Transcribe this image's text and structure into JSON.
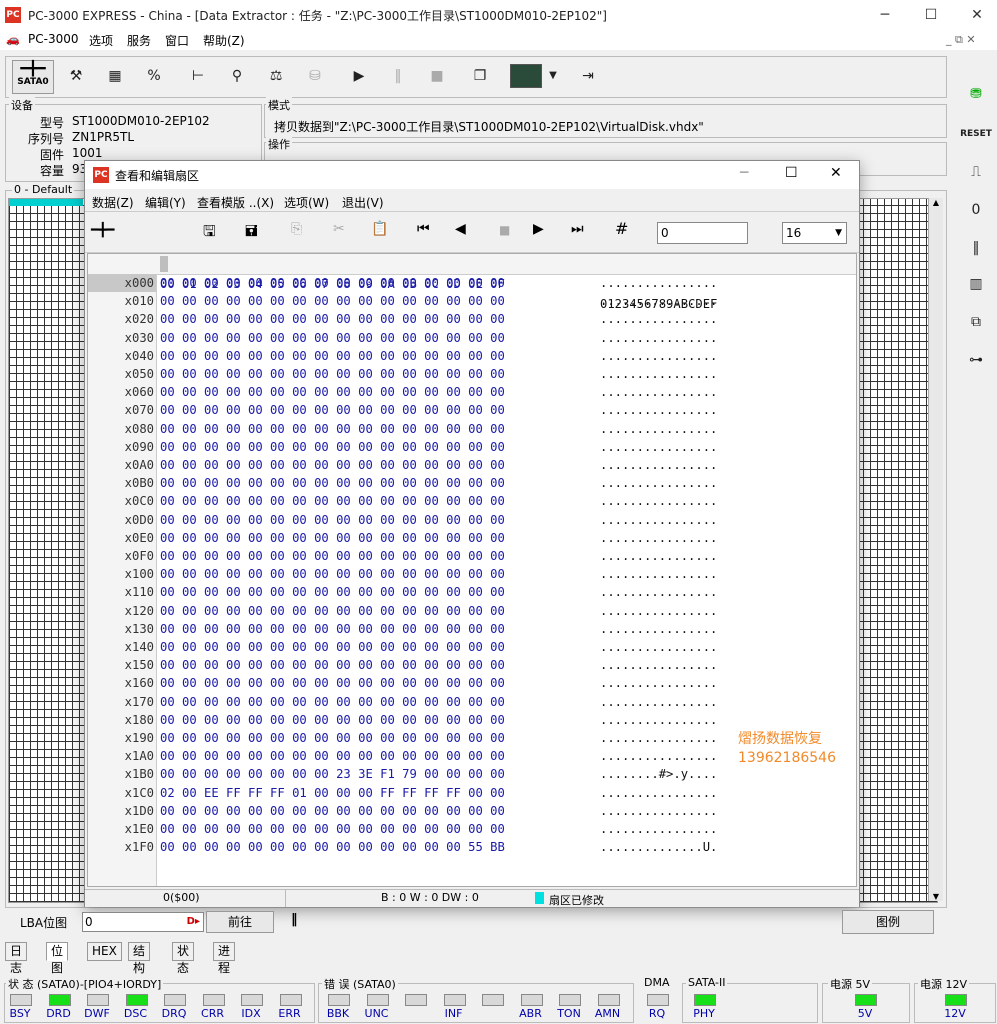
{
  "window": {
    "title": "PC-3000 EXPRESS - China - [Data Extractor : 任务 - \"Z:\\PC-3000工作目录\\ST1000DM010-2EP102\"]",
    "icon": "PC"
  },
  "menu": [
    "PC-3000",
    "选项",
    "服务",
    "窗口",
    "帮助(Z)"
  ],
  "toolbar": {
    "sata_label": "SATA0"
  },
  "device": {
    "group_label": "设备",
    "model_label": "型号",
    "model": "ST1000DM010-2EP102",
    "serial_label": "序列号",
    "serial": "ZN1PR5TL",
    "firmware_label": "固件",
    "firmware": "1001",
    "capacity_label": "容量",
    "capacity": "93"
  },
  "mode": {
    "group_label": "模式",
    "text": "拷贝数据到\"Z:\\PC-3000工作目录\\ST1000DM010-2EP102\\VirtualDisk.vhdx\""
  },
  "operation": {
    "group_label": "操作"
  },
  "map_label": "0 - Default",
  "dialog": {
    "title": "查看和编辑扇区",
    "menu": [
      "数据(Z)",
      "编辑(Y)",
      "查看模版 ..(X)",
      "选项(W)",
      "退出(V)"
    ],
    "sector_input": "0",
    "columns_select": "16",
    "header_hex": "00 01 02 03 04 05 06 07 08 09 0A 0B 0C 0D 0E 0F",
    "header_ascii": "0123456789ABCDEF",
    "rows": [
      {
        "off": "x000",
        "hex": "00 00 00 00 00 00 00 00 00 00 00 00 00 00 00 00",
        "ascii": "................"
      },
      {
        "off": "x010",
        "hex": "00 00 00 00 00 00 00 00 00 00 00 00 00 00 00 00",
        "ascii": "................"
      },
      {
        "off": "x020",
        "hex": "00 00 00 00 00 00 00 00 00 00 00 00 00 00 00 00",
        "ascii": "................"
      },
      {
        "off": "x030",
        "hex": "00 00 00 00 00 00 00 00 00 00 00 00 00 00 00 00",
        "ascii": "................"
      },
      {
        "off": "x040",
        "hex": "00 00 00 00 00 00 00 00 00 00 00 00 00 00 00 00",
        "ascii": "................"
      },
      {
        "off": "x050",
        "hex": "00 00 00 00 00 00 00 00 00 00 00 00 00 00 00 00",
        "ascii": "................"
      },
      {
        "off": "x060",
        "hex": "00 00 00 00 00 00 00 00 00 00 00 00 00 00 00 00",
        "ascii": "................"
      },
      {
        "off": "x070",
        "hex": "00 00 00 00 00 00 00 00 00 00 00 00 00 00 00 00",
        "ascii": "................"
      },
      {
        "off": "x080",
        "hex": "00 00 00 00 00 00 00 00 00 00 00 00 00 00 00 00",
        "ascii": "................"
      },
      {
        "off": "x090",
        "hex": "00 00 00 00 00 00 00 00 00 00 00 00 00 00 00 00",
        "ascii": "................"
      },
      {
        "off": "x0A0",
        "hex": "00 00 00 00 00 00 00 00 00 00 00 00 00 00 00 00",
        "ascii": "................"
      },
      {
        "off": "x0B0",
        "hex": "00 00 00 00 00 00 00 00 00 00 00 00 00 00 00 00",
        "ascii": "................"
      },
      {
        "off": "x0C0",
        "hex": "00 00 00 00 00 00 00 00 00 00 00 00 00 00 00 00",
        "ascii": "................"
      },
      {
        "off": "x0D0",
        "hex": "00 00 00 00 00 00 00 00 00 00 00 00 00 00 00 00",
        "ascii": "................"
      },
      {
        "off": "x0E0",
        "hex": "00 00 00 00 00 00 00 00 00 00 00 00 00 00 00 00",
        "ascii": "................"
      },
      {
        "off": "x0F0",
        "hex": "00 00 00 00 00 00 00 00 00 00 00 00 00 00 00 00",
        "ascii": "................"
      },
      {
        "off": "x100",
        "hex": "00 00 00 00 00 00 00 00 00 00 00 00 00 00 00 00",
        "ascii": "................"
      },
      {
        "off": "x110",
        "hex": "00 00 00 00 00 00 00 00 00 00 00 00 00 00 00 00",
        "ascii": "................"
      },
      {
        "off": "x120",
        "hex": "00 00 00 00 00 00 00 00 00 00 00 00 00 00 00 00",
        "ascii": "................"
      },
      {
        "off": "x130",
        "hex": "00 00 00 00 00 00 00 00 00 00 00 00 00 00 00 00",
        "ascii": "................"
      },
      {
        "off": "x140",
        "hex": "00 00 00 00 00 00 00 00 00 00 00 00 00 00 00 00",
        "ascii": "................"
      },
      {
        "off": "x150",
        "hex": "00 00 00 00 00 00 00 00 00 00 00 00 00 00 00 00",
        "ascii": "................"
      },
      {
        "off": "x160",
        "hex": "00 00 00 00 00 00 00 00 00 00 00 00 00 00 00 00",
        "ascii": "................"
      },
      {
        "off": "x170",
        "hex": "00 00 00 00 00 00 00 00 00 00 00 00 00 00 00 00",
        "ascii": "................"
      },
      {
        "off": "x180",
        "hex": "00 00 00 00 00 00 00 00 00 00 00 00 00 00 00 00",
        "ascii": "................"
      },
      {
        "off": "x190",
        "hex": "00 00 00 00 00 00 00 00 00 00 00 00 00 00 00 00",
        "ascii": "................"
      },
      {
        "off": "x1A0",
        "hex": "00 00 00 00 00 00 00 00 00 00 00 00 00 00 00 00",
        "ascii": "................"
      },
      {
        "off": "x1B0",
        "hex": "00 00 00 00 00 00 00 00 23 3E F1 79 00 00 00 00",
        "ascii": "........#>.y...."
      },
      {
        "off": "x1C0",
        "hex": "02 00 EE FF FF FF 01 00 00 00 FF FF FF FF 00 00",
        "ascii": "................"
      },
      {
        "off": "x1D0",
        "hex": "00 00 00 00 00 00 00 00 00 00 00 00 00 00 00 00",
        "ascii": "................"
      },
      {
        "off": "x1E0",
        "hex": "00 00 00 00 00 00 00 00 00 00 00 00 00 00 00 00",
        "ascii": "................"
      },
      {
        "off": "x1F0",
        "hex": "00 00 00 00 00 00 00 00 00 00 00 00 00 00 55 BB",
        "ascii": "..............U."
      }
    ],
    "watermark_line1": "熠扬数据恢复",
    "watermark_line2": "13962186546",
    "status_pos": "0($00)",
    "status_bw": "B : 0 W : 0 DW : 0",
    "status_modified": "扇区已修改"
  },
  "lba": {
    "label": "LBA位图",
    "value": "0",
    "btn_prev": "前往",
    "btn_legend": "图例"
  },
  "tabs": [
    "日志",
    "位图",
    "HEX",
    "结构",
    "状态",
    "进程"
  ],
  "status_panel": {
    "label": "状 态 (SATA0)-[PIO4+IORDY]",
    "leds": [
      {
        "name": "BSY",
        "on": false
      },
      {
        "name": "DRD",
        "on": true
      },
      {
        "name": "DWF",
        "on": false
      },
      {
        "name": "DSC",
        "on": true
      },
      {
        "name": "DRQ",
        "on": false
      },
      {
        "name": "CRR",
        "on": false
      },
      {
        "name": "IDX",
        "on": false
      },
      {
        "name": "ERR",
        "on": false
      }
    ]
  },
  "error_panel": {
    "label": "错 误 (SATA0)",
    "leds": [
      {
        "name": "BBK",
        "on": false
      },
      {
        "name": "UNC",
        "on": false
      },
      {
        "name": "",
        "on": false
      },
      {
        "name": "INF",
        "on": false
      },
      {
        "name": "",
        "on": false
      },
      {
        "name": "ABR",
        "on": false
      },
      {
        "name": "TON",
        "on": false
      },
      {
        "name": "AMN",
        "on": false
      }
    ]
  },
  "dma_panel": {
    "label": "DMA",
    "led": "RQ"
  },
  "sata_panel": {
    "label": "SATA-II",
    "led": "PHY"
  },
  "power5": {
    "label": "电源 5V",
    "led": "5V"
  },
  "power12": {
    "label": "电源 12V",
    "led": "12V"
  },
  "colors": {
    "hex": "#1a1aa8",
    "led_on": "#18e018",
    "watermark": "#f08a2a",
    "map_accent": "#00d0d0"
  }
}
